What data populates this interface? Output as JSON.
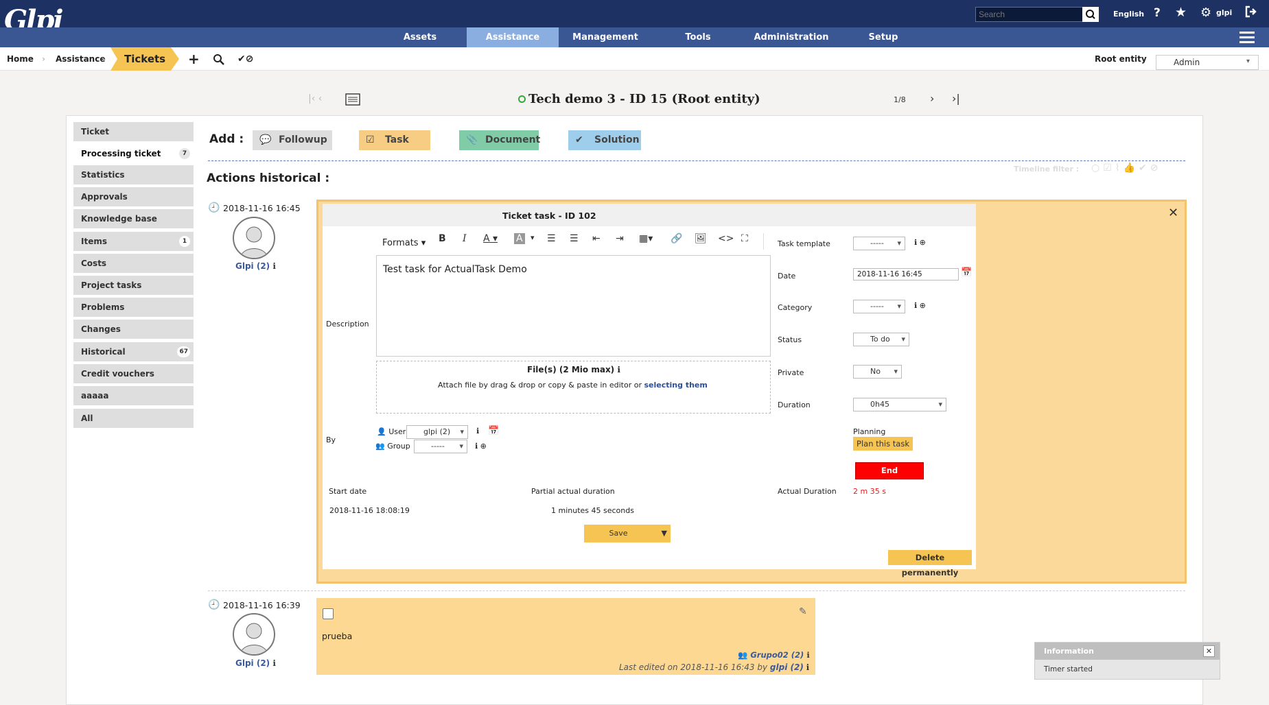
{
  "header": {
    "logo": "Glpi",
    "search_placeholder": "Search",
    "language": "English",
    "help_icon": "help-icon",
    "user": "glpi",
    "menu": [
      {
        "label": "Assets"
      },
      {
        "label": "Assistance"
      },
      {
        "label": "Management"
      },
      {
        "label": "Tools"
      },
      {
        "label": "Administration"
      },
      {
        "label": "Setup"
      }
    ]
  },
  "breadcrumb": {
    "home": "Home",
    "assistance": "Assistance",
    "tickets": "Tickets",
    "entity_label": "Root entity",
    "entity_value": "Admin"
  },
  "record": {
    "title": "Tech demo 3 - ID 15 (Root entity)",
    "pager": "1/8"
  },
  "sidebar": {
    "items": [
      {
        "label": "Ticket",
        "badge": ""
      },
      {
        "label": "Processing ticket",
        "badge": "7"
      },
      {
        "label": "Statistics",
        "badge": ""
      },
      {
        "label": "Approvals",
        "badge": ""
      },
      {
        "label": "Knowledge base",
        "badge": ""
      },
      {
        "label": "Items",
        "badge": "1"
      },
      {
        "label": "Costs",
        "badge": ""
      },
      {
        "label": "Project tasks",
        "badge": ""
      },
      {
        "label": "Problems",
        "badge": ""
      },
      {
        "label": "Changes",
        "badge": ""
      },
      {
        "label": "Historical",
        "badge": "67"
      },
      {
        "label": "Credit vouchers",
        "badge": ""
      },
      {
        "label": "aaaaa",
        "badge": ""
      },
      {
        "label": "All",
        "badge": ""
      }
    ]
  },
  "actions": {
    "add_label": "Add :",
    "followup": "Followup",
    "task": "Task",
    "document": "Document",
    "solution": "Solution",
    "historical_title": "Actions historical :",
    "timeline_filter": "Timeline filter :"
  },
  "entry1": {
    "date": "2018-11-16 16:45",
    "author": "Glpi (2)"
  },
  "task_form": {
    "title": "Ticket task - ID 102",
    "formats": "Formats",
    "description_label": "Description",
    "description_text": "Test task for ActualTask Demo",
    "files_title": "File(s) (2 Mio max)",
    "files_hint": "Attach file by drag & drop or copy & paste in editor or",
    "files_link": "selecting them",
    "by_label": "By",
    "user_label": "User",
    "user_value": "glpi (2)",
    "group_label": "Group",
    "group_value": "-----",
    "task_template_label": "Task template",
    "task_template_value": "-----",
    "date_label": "Date",
    "date_value": "2018-11-16 16:45",
    "category_label": "Category",
    "category_value": "-----",
    "status_label": "Status",
    "status_value": "To do",
    "private_label": "Private",
    "private_value": "No",
    "duration_label": "Duration",
    "duration_value": "0h45",
    "planning_label": "Planning",
    "plan_button": "Plan this task",
    "end_button": "End",
    "start_date_label": "Start date",
    "start_date_value": "2018-11-16 18:08:19",
    "partial_label": "Partial actual duration",
    "partial_value": "1 minutes 45 seconds",
    "actual_label": "Actual Duration",
    "actual_value": "2 m 35 s",
    "save_button": "Save",
    "delete_button": "Delete permanently"
  },
  "entry2": {
    "date": "2018-11-16 16:39",
    "author": "Glpi (2)",
    "content": "prueba",
    "group": "Grupo02 (2)",
    "last_edited_prefix": "Last edited on 2018-11-16 16:43 by",
    "last_edited_user": "glpi (2)"
  },
  "notification": {
    "title": "Information",
    "message": "Timer started"
  },
  "colors": {
    "header_dark": "#1d3262",
    "menu_blue": "#3a5693",
    "task_yellow": "#fbd99a",
    "end_red": "#ff0000",
    "duration_red": "#e02020"
  }
}
